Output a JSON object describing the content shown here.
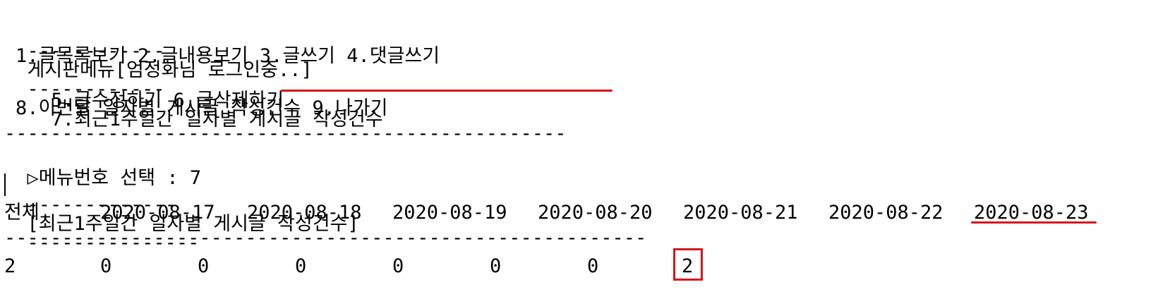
{
  "menu": {
    "top_dashes_left": "------------",
    "title": "게시판메뉴[엄정화님 로그인중..]",
    "top_dashes_right": "------------",
    "row1": "1.글목록보기 2.글내용보기 3.글쓰기 4.댓글쓰기",
    "row2_prefix": "5.글수정하기 6.글삭제하기",
    "row2_highlight": "7.최근1주일간 일자별 게시글 작성건수",
    "row3": "8.이번달 일자별 게시글 작성건수 9.나가기",
    "bottom_dashes": "-------------------------------------------------"
  },
  "prompt": {
    "arrow_icon": "triangle-right-icon",
    "arrow_glyph": "▷",
    "label": "메뉴번호 선택 : ",
    "value": "7"
  },
  "report": {
    "dashes_left": "-------------",
    "title": "[최근1주일간 일자별 게시글 작성건수]",
    "dashes_right": "---------------",
    "headers": [
      "전체",
      "2020-08-17",
      "2020-08-18",
      "2020-08-19",
      "2020-08-20",
      "2020-08-21",
      "2020-08-22",
      "2020-08-23"
    ],
    "separator": "--------------------------------------------------------",
    "values": [
      "2",
      "0",
      "0",
      "0",
      "0",
      "0",
      "0",
      "2"
    ]
  },
  "annotations": {
    "color": "#d8141e"
  }
}
